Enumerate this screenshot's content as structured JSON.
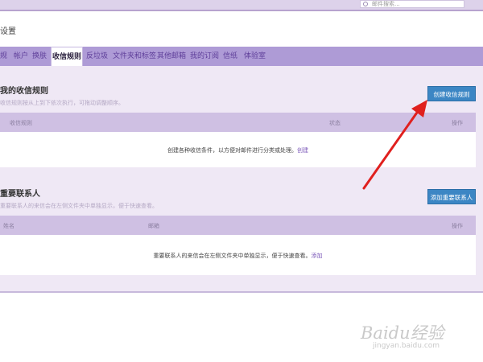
{
  "header": {
    "search_placeholder": "邮件搜索..."
  },
  "page_title": "设置",
  "tabs": [
    {
      "label": "规"
    },
    {
      "label": "帐户"
    },
    {
      "label": "换肤"
    },
    {
      "label": "收信规则"
    },
    {
      "label": "反垃圾"
    },
    {
      "label": "文件夹和标签"
    },
    {
      "label": "其他邮箱"
    },
    {
      "label": "我的订阅"
    },
    {
      "label": "信纸"
    },
    {
      "label": "体验室"
    }
  ],
  "rules_section": {
    "title": "我的收信规则",
    "description": "收信规则按从上到下依次执行，可拖动调整顺序。",
    "create_button": "创建收信规则",
    "columns": {
      "name": "收信规则",
      "status": "状态",
      "action": "操作"
    },
    "empty_message": "创建各种收信条件，以方便对邮件进行分类或处理。",
    "empty_link": "创建"
  },
  "contacts_section": {
    "title": "重要联系人",
    "description": "重要联系人的来信会在左侧文件夹中单独显示，便于快速查看。",
    "add_button": "添加重要联系人",
    "columns": {
      "name": "姓名",
      "email": "邮箱",
      "action": "操作"
    },
    "empty_message": "重要联系人的来信会在左侧文件夹中单独显示，便于快速查看。",
    "empty_link": "添加"
  },
  "watermark": {
    "brand": "Baidu经验",
    "url": "jingyan.baidu.com"
  },
  "colors": {
    "tab_bar": "#ae9bd6",
    "panel": "#efe8f5",
    "button": "#3c86c4",
    "arrow": "#e0201e"
  }
}
